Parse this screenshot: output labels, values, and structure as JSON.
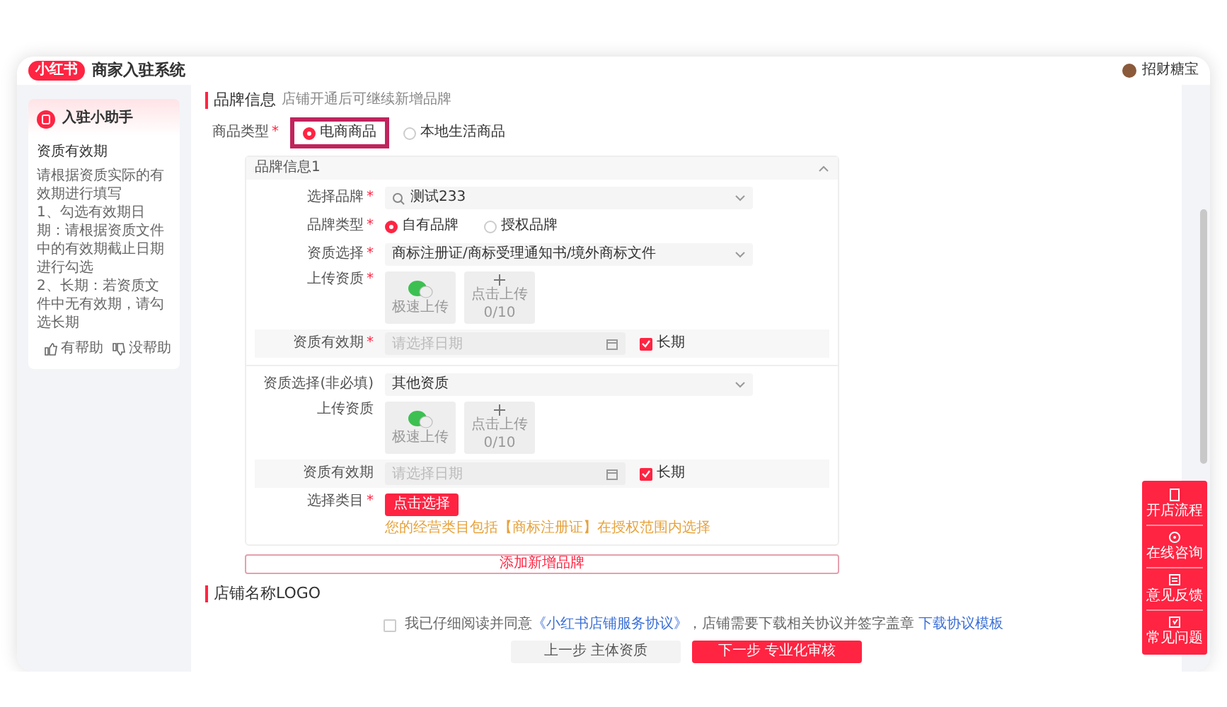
{
  "header": {
    "logo": "小红书",
    "title": "商家入驻系统",
    "user": "招财糖宝"
  },
  "helper": {
    "title": "入驻小助手",
    "heading": "资质有效期",
    "lines": [
      "请根据资质实际的有效期进行填写",
      "1、勾选有效期日期：请根据资质文件中的有效期截止日期进行勾选",
      "2、长期：若资质文件中无有效期，请勾选长期"
    ],
    "feedback": [
      {
        "kind": "like",
        "label": "有帮助"
      },
      {
        "kind": "dislike",
        "label": "没帮助"
      }
    ]
  },
  "brand_section": {
    "title": "品牌信息",
    "hint": "店铺开通后可继续新增品牌"
  },
  "product_type": {
    "label": "商品类型",
    "mark": "*",
    "options": [
      {
        "label": "电商商品",
        "selected": true,
        "highlighted": true
      },
      {
        "label": "本地生活商品",
        "selected": false,
        "highlighted": false
      }
    ]
  },
  "brand_panel": {
    "title": "品牌信息1",
    "expanded": true,
    "groups": [
      {
        "rows": [
          {
            "kind": "select",
            "label": "选择品牌",
            "mark": "*",
            "value": "测试233",
            "search": true
          },
          {
            "kind": "radio",
            "label": "品牌类型",
            "mark": "*",
            "options": [
              {
                "label": "自有品牌",
                "selected": true
              },
              {
                "label": "授权品牌",
                "selected": false
              }
            ]
          },
          {
            "kind": "select",
            "label": "资质选择",
            "mark": "*",
            "value": "商标注册证/商标受理通知书/境外商标文件",
            "search": false
          },
          {
            "kind": "upload",
            "label": "上传资质",
            "mark": "*",
            "tiles": [
              {
                "kind": "quick",
                "label": "极速上传"
              },
              {
                "kind": "add",
                "label": "点击上传",
                "count": "0/10"
              }
            ]
          },
          {
            "kind": "date",
            "label": "资质有效期",
            "mark": "*",
            "placeholder": "请选择日期",
            "long_term": {
              "label": "长期",
              "checked": true
            }
          }
        ]
      },
      {
        "rows": [
          {
            "kind": "select",
            "label": "资质选择(非必填)",
            "value": "其他资质",
            "search": false
          },
          {
            "kind": "upload",
            "label": "上传资质",
            "tiles": [
              {
                "kind": "quick",
                "label": "极速上传"
              },
              {
                "kind": "add",
                "label": "点击上传",
                "count": "0/10"
              }
            ]
          },
          {
            "kind": "date",
            "label": "资质有效期",
            "placeholder": "请选择日期",
            "long_term": {
              "label": "长期",
              "checked": true
            }
          },
          {
            "kind": "category",
            "label": "选择类目",
            "mark": "*",
            "button": "点击选择",
            "hint": "您的经营类目包括【商标注册证】在授权范围内选择"
          }
        ]
      }
    ]
  },
  "add_brand": "添加新增品牌",
  "logo_section": {
    "title": "店铺名称LOGO"
  },
  "agreement": {
    "checked": false,
    "text_before": "我已仔细阅读并同意",
    "link": "《小红书店铺服务协议》",
    "text_after": "，店铺需要下载相关协议并签字盖章",
    "download_link": "下载协议模板"
  },
  "buttons": [
    {
      "kind": "secondary",
      "label": "上一步 主体资质"
    },
    {
      "kind": "primary",
      "label": "下一步 专业化审核"
    }
  ],
  "float_bar": [
    {
      "kind": "flow",
      "label": "开店流程"
    },
    {
      "kind": "chat",
      "label": "在线咨询"
    },
    {
      "kind": "feedback",
      "label": "意见反馈"
    },
    {
      "kind": "faq",
      "label": "常见问题"
    }
  ]
}
